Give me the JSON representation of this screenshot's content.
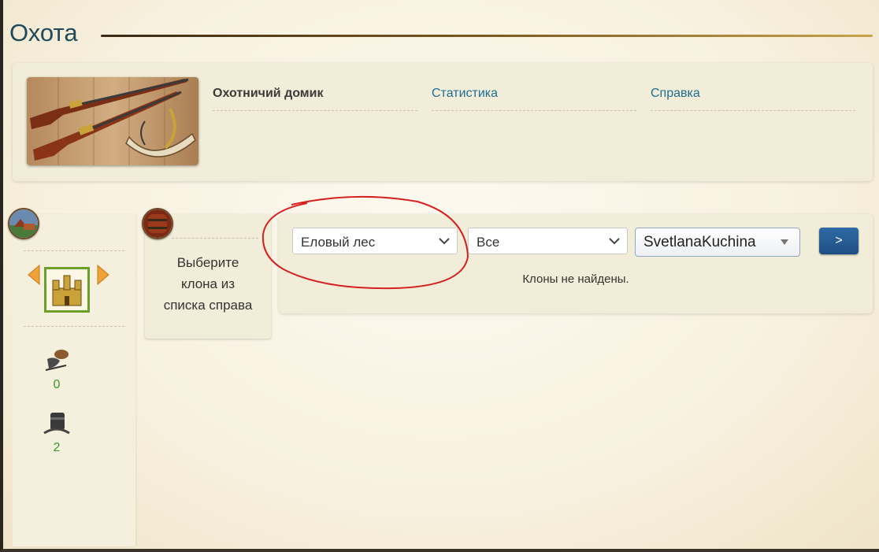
{
  "page": {
    "title": "Охота"
  },
  "header": {
    "links": [
      {
        "label": "Охотничий домик"
      },
      {
        "label": "Статистика"
      },
      {
        "label": "Справка"
      }
    ]
  },
  "clone_prompt": {
    "line1": "Выберите",
    "line2": "клона из",
    "line3": "списка справа"
  },
  "filters": {
    "location": "Еловый лес",
    "type": "Все",
    "user": "SvetlanaKuchina",
    "go_label": ">"
  },
  "empty_message": "Клоны не найдены.",
  "resources": [
    {
      "icon": "bait-icon",
      "count": "0"
    },
    {
      "icon": "barrel-icon",
      "count": "2"
    }
  ],
  "colors": {
    "title": "#1f4a5a",
    "link": "#1e6d92",
    "count": "#3a9a2a",
    "button": "#1e4f82",
    "annotation": "#d42020"
  }
}
